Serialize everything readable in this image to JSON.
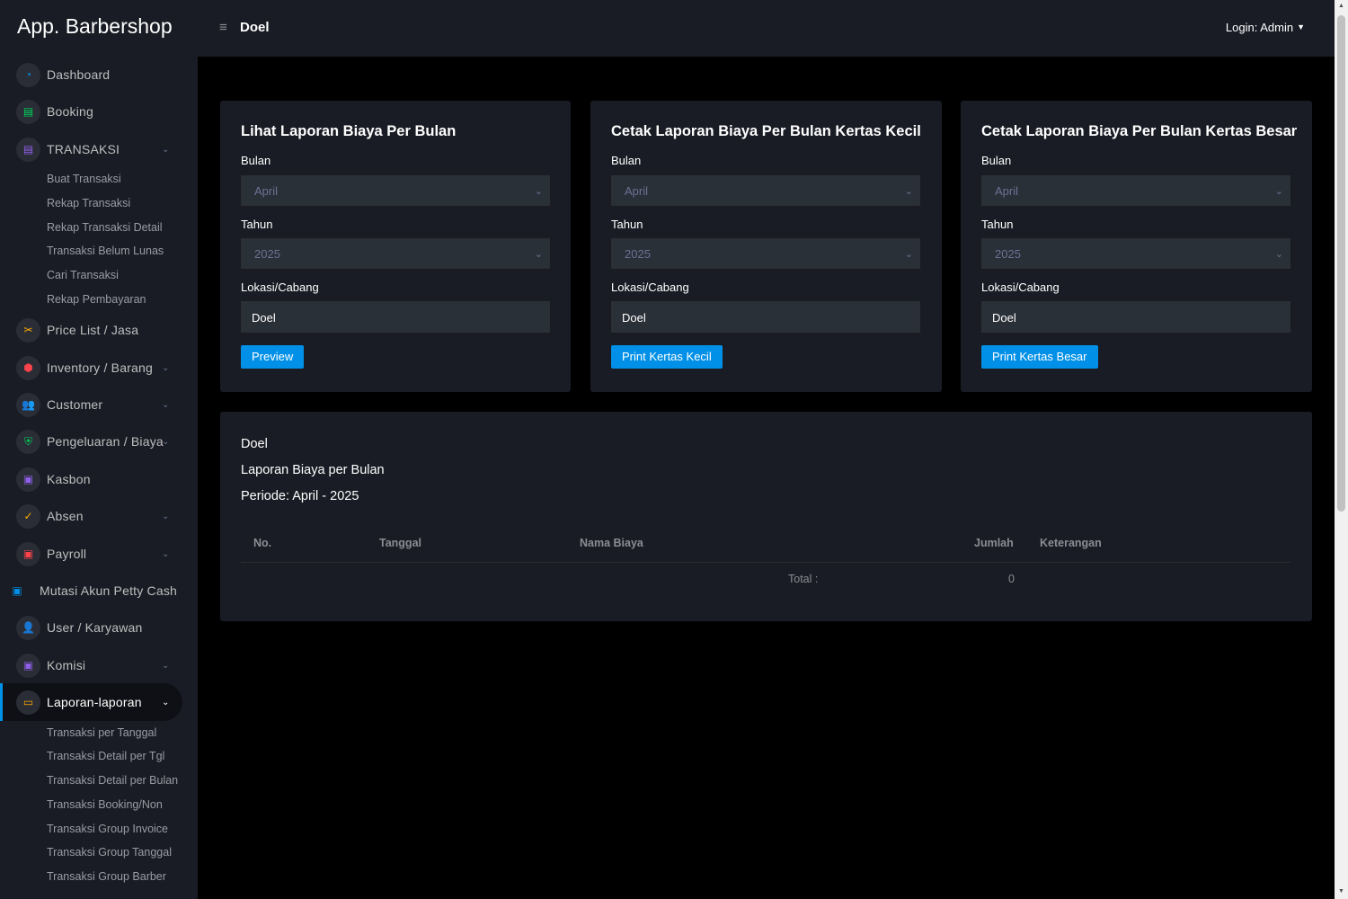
{
  "app": {
    "title": "App. Barbershop"
  },
  "header": {
    "menu_icon": "≡",
    "branch": "Doel",
    "login": "Login: Admin"
  },
  "sidebar": {
    "items": [
      {
        "label": "Dashboard",
        "icon": "dashboard-icon"
      },
      {
        "label": "Booking",
        "icon": "booking-icon"
      },
      {
        "label": "TRANSAKSI",
        "icon": "transaction-icon"
      },
      {
        "label": "Price List / Jasa",
        "icon": "scissors-icon"
      },
      {
        "label": "Inventory / Barang",
        "icon": "inventory-icon"
      },
      {
        "label": "Customer",
        "icon": "customer-icon"
      },
      {
        "label": "Pengeluaran / Biaya",
        "icon": "shield-icon"
      },
      {
        "label": "Kasbon",
        "icon": "money-icon"
      },
      {
        "label": "Absen",
        "icon": "check-icon"
      },
      {
        "label": "Payroll",
        "icon": "payroll-icon"
      },
      {
        "label": "Mutasi Akun Petty Cash",
        "icon": "money-icon"
      },
      {
        "label": "User / Karyawan",
        "icon": "user-icon"
      },
      {
        "label": "Komisi",
        "icon": "money-icon"
      },
      {
        "label": "Laporan-laporan",
        "icon": "laptop-icon"
      }
    ],
    "transaksi_sub": [
      "Buat Transaksi",
      "Rekap Transaksi",
      "Rekap Transaksi Detail",
      "Transaksi Belum Lunas",
      "Cari Transaksi",
      "Rekap Pembayaran"
    ],
    "laporan_sub": [
      "Transaksi per Tanggal",
      "Transaksi Detail per Tgl",
      "Transaksi Detail per Bulan",
      "Transaksi Booking/Non",
      "Transaksi Group Invoice",
      "Transaksi Group Tanggal",
      "Transaksi Group Barber"
    ]
  },
  "cards": [
    {
      "title": "Lihat Laporan Biaya Per Bulan",
      "button": "Preview"
    },
    {
      "title": "Cetak Laporan Biaya Per Bulan Kertas Kecil",
      "button": "Print Kertas Kecil"
    },
    {
      "title": "Cetak Laporan Biaya Per Bulan Kertas Besar",
      "button": "Print Kertas Besar"
    }
  ],
  "form": {
    "bulan_label": "Bulan",
    "bulan_value": "April",
    "tahun_label": "Tahun",
    "tahun_value": "2025",
    "lokasi_label": "Lokasi/Cabang",
    "lokasi_value": "Doel"
  },
  "report": {
    "branch": "Doel",
    "title": "Laporan Biaya per Bulan",
    "period": "Periode: April - 2025",
    "columns": [
      "No.",
      "Tanggal",
      "Nama Biaya",
      "Jumlah",
      "Keterangan"
    ],
    "total_label": "Total :",
    "total_value": "0"
  }
}
